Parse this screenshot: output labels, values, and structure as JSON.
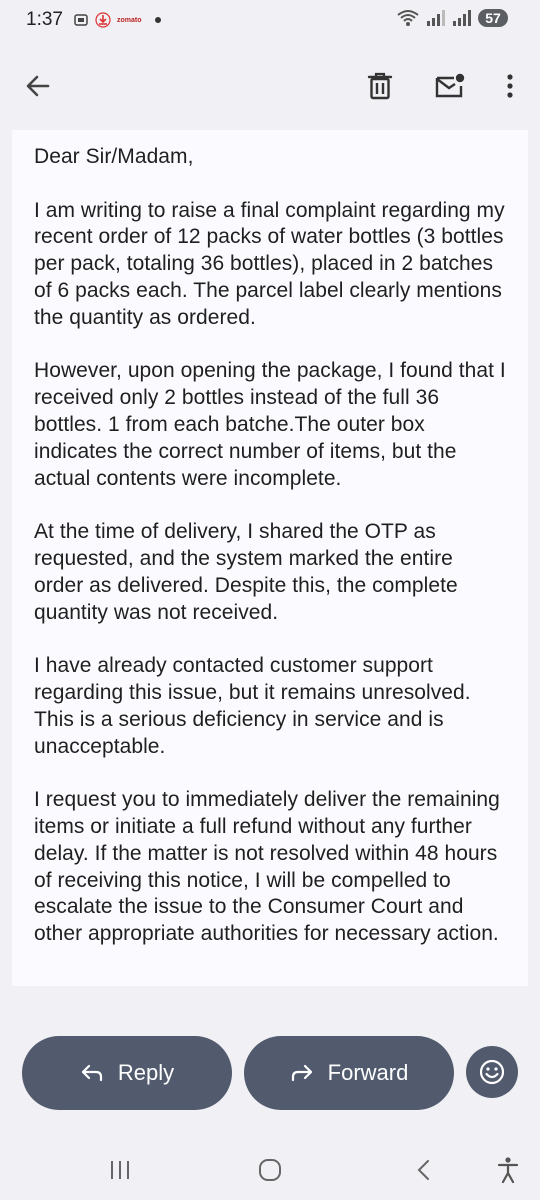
{
  "status": {
    "time": "1:37",
    "notif_brand": "zomato",
    "battery": "57"
  },
  "toolbar": {
    "back_icon": "arrow-left-icon",
    "delete_icon": "trash-icon",
    "unread_icon": "mark-unread-icon",
    "more_icon": "more-vert-icon"
  },
  "email": {
    "paragraphs": [
      "Dear Sir/Madam,",
      "I am writing to raise a final complaint regarding my recent order of 12 packs of water bottles (3 bottles per pack, totaling 36 bottles), placed in 2 batches of 6 packs each. The parcel label clearly mentions the quantity as ordered.",
      "However, upon opening the package, I found that I received only 2 bottles instead of the full 36 bottles. 1 from each batche.The outer box indicates the correct number of items, but the actual contents were incomplete.",
      "At the time of delivery, I shared the OTP as requested, and the system marked the entire order as delivered. Despite this, the complete quantity was not received.",
      "I have already contacted customer support regarding this issue, but it remains unresolved. This is a serious deficiency in service and is unacceptable.",
      "I request you to immediately deliver the remaining items or initiate a full refund without any further delay. If the matter is not resolved within 48 hours of receiving this notice, I will be compelled to escalate the issue to the Consumer Court and other appropriate authorities for necessary action."
    ]
  },
  "actions": {
    "reply_label": "Reply",
    "forward_label": "Forward"
  },
  "colors": {
    "pill_bg": "#525a6e",
    "body_bg": "#fbfbff",
    "page_bg": "#f1f1f5"
  }
}
